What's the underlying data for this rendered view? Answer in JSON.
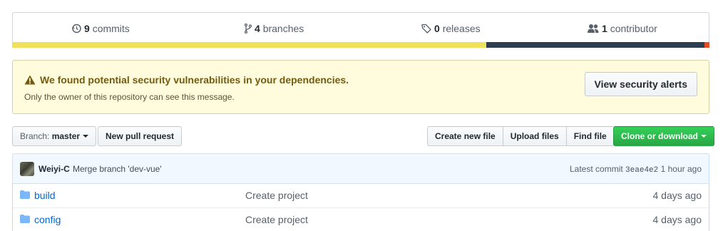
{
  "summary": {
    "commits": {
      "count": "9",
      "label": "commits",
      "icon": "history-icon"
    },
    "branches": {
      "count": "4",
      "label": "branches",
      "icon": "git-branch-icon"
    },
    "releases": {
      "count": "0",
      "label": "releases",
      "icon": "tag-icon"
    },
    "contributors": {
      "count": "1",
      "label": "contributor",
      "icon": "people-icon"
    }
  },
  "language_bar": [
    {
      "color": "#f1e05a",
      "percent": 68
    },
    {
      "color": "#2c3e50",
      "percent": 31.3
    },
    {
      "color": "#e34c26",
      "percent": 0.7
    }
  ],
  "alert": {
    "title": "We found potential security vulnerabilities in your dependencies.",
    "subtitle": "Only the owner of this repository can see this message.",
    "button": "View security alerts",
    "icon": "alert-icon"
  },
  "toolbar": {
    "branch_label": "Branch:",
    "branch_value": "master",
    "new_pull_request": "New pull request",
    "create_new_file": "Create new file",
    "upload_files": "Upload files",
    "find_file": "Find file",
    "clone_or_download": "Clone or download"
  },
  "commit_tease": {
    "author": "Weiyi-C",
    "message": "Merge branch 'dev-vue'",
    "latest_label": "Latest commit",
    "sha": "3eae4e2",
    "age": "1 hour ago"
  },
  "files": [
    {
      "name": "build",
      "type": "directory",
      "icon": "folder-icon",
      "message": "Create project",
      "age": "4 days ago"
    },
    {
      "name": "config",
      "type": "directory",
      "icon": "folder-icon",
      "message": "Create project",
      "age": "4 days ago"
    }
  ]
}
